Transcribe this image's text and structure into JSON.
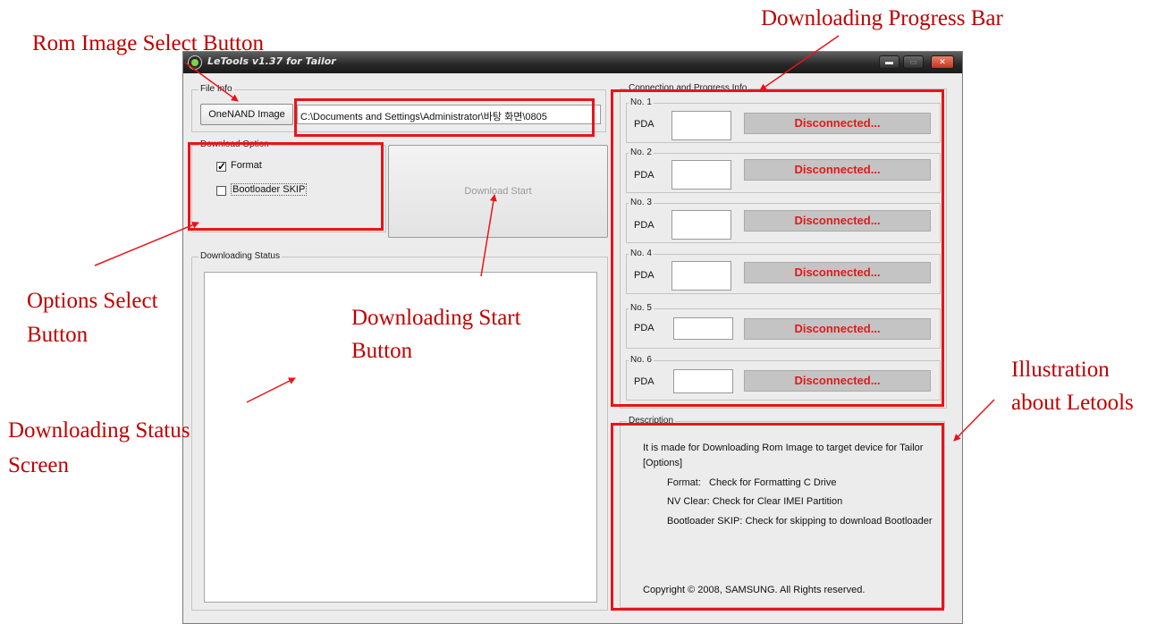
{
  "annotations": {
    "rom_image_select": "Rom Image Select Button",
    "downloading_progress_bar": "Downloading Progress Bar",
    "options_select_line1": "Options Select",
    "options_select_line2": "Button",
    "downloading_start_line1": "Downloading Start",
    "downloading_start_line2": "Button",
    "downloading_status_line1": "Downloading Status",
    "downloading_status_line2": "Screen",
    "illustration_line1": "Illustration",
    "illustration_line2": "about Letools"
  },
  "window": {
    "title": "LeTools  v1.37 for Tailor",
    "minimize_glyph": "▬",
    "maximize_glyph": "▭",
    "close_glyph": "✕"
  },
  "file_info": {
    "legend": "File Info",
    "onenand_button": "OneNAND Image",
    "path_value": "C:\\Documents and Settings\\Administrator\\바탕 화면\\0805"
  },
  "download_option": {
    "legend": "Download Option",
    "format_label": "Format",
    "format_checked": true,
    "check_glyph": "✓",
    "bootloader_label": "Bootloader SKIP",
    "bootloader_checked": false,
    "start_button": "Download Start"
  },
  "downloading_status": {
    "legend": "Downloading Status"
  },
  "connection": {
    "legend": "Connection and Progress Info",
    "slots": [
      {
        "label": "No. 1",
        "pda": "PDA",
        "status": "Disconnected..."
      },
      {
        "label": "No. 2",
        "pda": "PDA",
        "status": "Disconnected..."
      },
      {
        "label": "No. 3",
        "pda": "PDA",
        "status": "Disconnected..."
      },
      {
        "label": "No. 4",
        "pda": "PDA",
        "status": "Disconnected..."
      },
      {
        "label": "No. 5",
        "pda": "PDA",
        "status": "Disconnected..."
      },
      {
        "label": "No. 6",
        "pda": "PDA",
        "status": "Disconnected..."
      }
    ]
  },
  "description": {
    "legend": "Description",
    "lines": [
      "It is made for Downloading Rom Image to target device for Tailor",
      "[Options]",
      "Format:   Check for Formatting C Drive",
      "NV Clear: Check for Clear IMEI Partition",
      "Bootloader SKIP: Check for skipping to download Bootloader"
    ],
    "copyright": "Copyright © 2008, SAMSUNG. All Rights reserved."
  },
  "colors": {
    "annotation_red": "#c00000",
    "highlight_red": "#e8141a",
    "status_text_red": "#e01a1a",
    "status_bar_gray": "#c4c4c4"
  }
}
